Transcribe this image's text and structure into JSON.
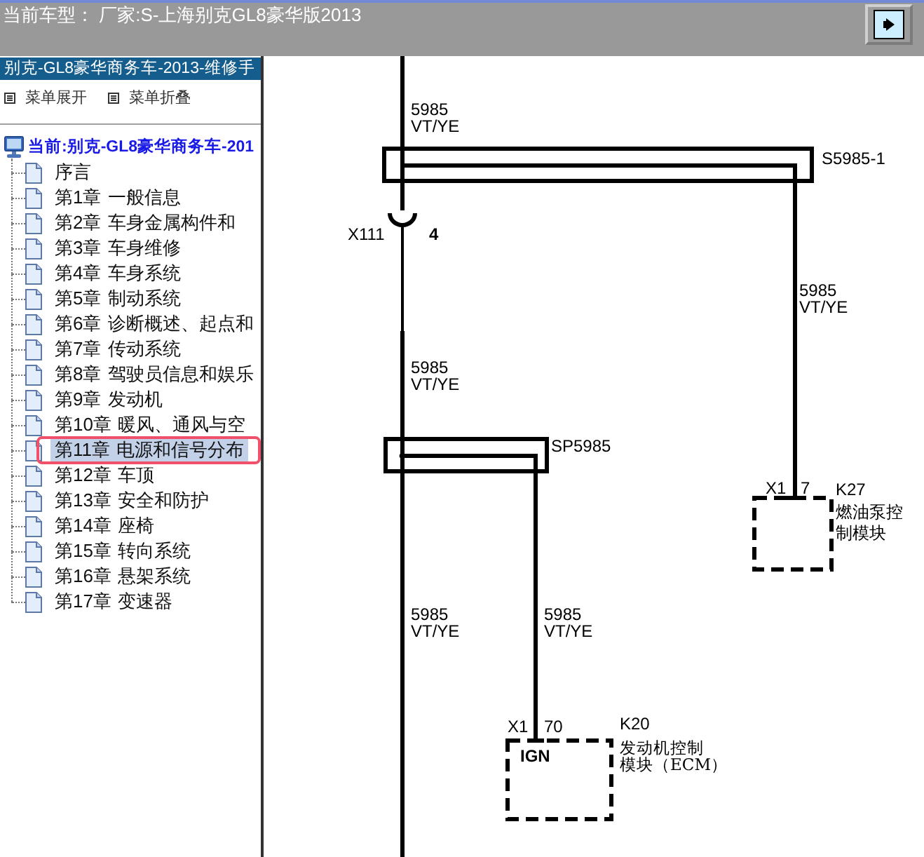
{
  "top_bar": {
    "title": "当前车型： 厂家:S-上海别克GL8豪华版2013"
  },
  "sidebar": {
    "title": "别克-GL8豪华商务车-2013-维修手",
    "menu_actions": [
      {
        "label": "菜单展开"
      },
      {
        "label": "菜单折叠"
      }
    ],
    "tree": {
      "label": "当前:别克-GL8豪华商务车-201",
      "children": [
        {
          "label": "序言",
          "selected": false,
          "highlighted": false
        },
        {
          "label": "第1章 一般信息",
          "selected": false,
          "highlighted": false
        },
        {
          "label": "第2章 车身金属构件和",
          "selected": false,
          "highlighted": false
        },
        {
          "label": "第3章 车身维修",
          "selected": false,
          "highlighted": false
        },
        {
          "label": "第4章 车身系统",
          "selected": false,
          "highlighted": false
        },
        {
          "label": "第5章 制动系统",
          "selected": false,
          "highlighted": false
        },
        {
          "label": "第6章 诊断概述、起点和",
          "selected": false,
          "highlighted": false
        },
        {
          "label": "第7章 传动系统",
          "selected": false,
          "highlighted": false
        },
        {
          "label": "第8章 驾驶员信息和娱乐",
          "selected": false,
          "highlighted": false
        },
        {
          "label": "第9章 发动机",
          "selected": false,
          "highlighted": false
        },
        {
          "label": "第10章 暖风、通风与空",
          "selected": false,
          "highlighted": false
        },
        {
          "label": "第11章 电源和信号分布",
          "selected": true,
          "highlighted": true
        },
        {
          "label": "第12章 车顶",
          "selected": false,
          "highlighted": false
        },
        {
          "label": "第13章 安全和防护",
          "selected": false,
          "highlighted": false
        },
        {
          "label": "第14章 座椅",
          "selected": false,
          "highlighted": false
        },
        {
          "label": "第15章 转向系统",
          "selected": false,
          "highlighted": false
        },
        {
          "label": "第16章 悬架系统",
          "selected": false,
          "highlighted": false
        },
        {
          "label": "第17章 变速器",
          "selected": false,
          "highlighted": false
        }
      ]
    }
  },
  "diagram": {
    "wire_labels": [
      {
        "circuit": "5985",
        "color_code": "VT/YE"
      },
      {
        "circuit": "5985",
        "color_code": "VT/YE"
      },
      {
        "circuit": "5985",
        "color_code": "VT/YE"
      },
      {
        "circuit": "5985",
        "color_code": "VT/YE"
      },
      {
        "circuit": "5985",
        "color_code": "VT/YE"
      }
    ],
    "splices": [
      {
        "name": "S5985-1"
      },
      {
        "name": "SP5985"
      }
    ],
    "inline_connector": {
      "name": "X111",
      "pin": "4"
    },
    "modules": [
      {
        "ref": "K27",
        "description": [
          "燃油泵控",
          "制模块"
        ],
        "connector": "X1",
        "pin": "7"
      },
      {
        "ref": "K20",
        "description": [
          "发动机控制",
          "模块（ECM）"
        ],
        "connector": "X1",
        "pin": "70",
        "pin_function": "IGN"
      }
    ]
  }
}
